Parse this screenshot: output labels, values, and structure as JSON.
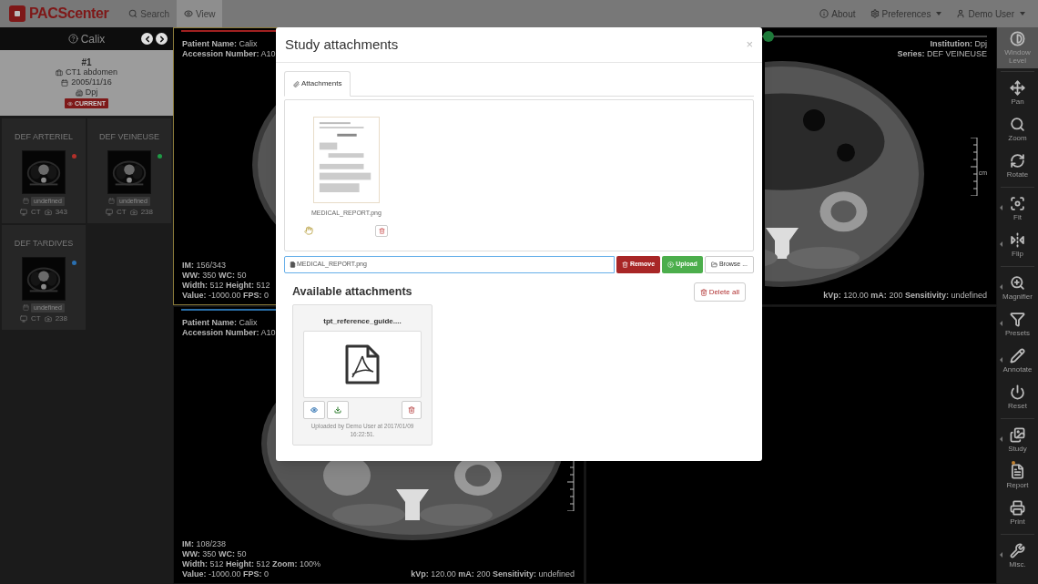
{
  "navbar": {
    "brand": "PACScenter",
    "items": [
      {
        "label": "Search",
        "selected": false
      },
      {
        "label": "View",
        "selected": true
      }
    ],
    "right_items": [
      {
        "label": "About",
        "dropdown": false
      },
      {
        "label": "Preferences",
        "dropdown": true
      },
      {
        "label": "Demo User",
        "dropdown": true
      }
    ]
  },
  "sidebar": {
    "patient": "Calix",
    "study": {
      "number": "#1",
      "description": "CT1 abdomen",
      "date": "2005/11/16",
      "institution": "Dpj",
      "badge": "CURRENT"
    },
    "series": [
      {
        "title": "DEF ARTERIEL",
        "color": "#b0302a",
        "date": "undefined",
        "modality": "CT",
        "images": "343"
      },
      {
        "title": "DEF VEINEUSE",
        "color": "#1f9a45",
        "date": "undefined",
        "modality": "CT",
        "images": "238"
      },
      {
        "title": "DEF TARDIVES",
        "color": "#2a6fb0",
        "date": "undefined",
        "modality": "CT",
        "images": "238"
      }
    ]
  },
  "viewports": [
    {
      "selected": true,
      "color": "#a02020",
      "image": {
        "kind": "picture"
      },
      "top_left": [
        [
          {
            "label": "Patient Name:",
            "value": "Calix"
          }
        ],
        [
          {
            "label": "Accession Number:",
            "value": "A10"
          }
        ]
      ],
      "bottom_left": [
        [
          {
            "label": "IM:",
            "value": "156/343"
          }
        ],
        [
          {
            "label": "WW:",
            "value": "350"
          },
          {
            "label": "WC:",
            "value": "50"
          }
        ],
        [
          {
            "label": "Width:",
            "value": "512"
          },
          {
            "label": "Height:",
            "value": "512"
          }
        ],
        [
          {
            "label": "Value:",
            "value": "-1000.00"
          },
          {
            "label": "FPS:",
            "value": "0"
          }
        ]
      ]
    },
    {
      "selected": false,
      "slider": {
        "level": 0.45
      },
      "image": {
        "kind": "picture"
      },
      "ruler_unit": "cm",
      "top_right": [
        [
          {
            "label": "Institution:",
            "value": "Dpj"
          }
        ],
        [
          {
            "label": "Series:",
            "value": "DEF VEINEUSE"
          }
        ]
      ],
      "bottom_right": [
        [
          {
            "label": "kVp:",
            "value": "120.00"
          },
          {
            "label": "mA:",
            "value": "200"
          },
          {
            "label": "Sensitivity:",
            "value": "undefined"
          }
        ]
      ]
    },
    {
      "selected": false,
      "color": "#2a6fa8",
      "image": {
        "kind": "picture"
      },
      "top_left": [
        [
          {
            "label": "Patient Name:",
            "value": "Calix"
          }
        ],
        [
          {
            "label": "Accession Number:",
            "value": "A10"
          }
        ]
      ],
      "bottom_left": [
        [
          {
            "label": "IM:",
            "value": "108/238"
          }
        ],
        [
          {
            "label": "WW:",
            "value": "350"
          },
          {
            "label": "WC:",
            "value": "50"
          }
        ],
        [
          {
            "label": "Width:",
            "value": "512"
          },
          {
            "label": "Height:",
            "value": "512"
          },
          {
            "label": "Zoom:",
            "value": "100%"
          }
        ],
        [
          {
            "label": "Value:",
            "value": "-1000.00"
          },
          {
            "label": "FPS:",
            "value": "0"
          }
        ]
      ],
      "bottom_right": [
        [
          {
            "label": "kVp:",
            "value": "120.00"
          },
          {
            "label": "mA:",
            "value": "200"
          },
          {
            "label": "Sensitivity:",
            "value": "undefined"
          }
        ]
      ]
    },
    {
      "selected": false
    }
  ],
  "toolbar": {
    "groups": [
      {
        "items": [
          {
            "label": "Window Level",
            "selected": true,
            "submenu": false
          }
        ]
      },
      {
        "items": [
          {
            "label": "Pan",
            "selected": false,
            "submenu": false
          },
          {
            "label": "Zoom",
            "selected": false,
            "submenu": false
          },
          {
            "label": "Rotate",
            "selected": false,
            "submenu": false
          }
        ]
      },
      {
        "items": [
          {
            "label": "Fit",
            "selected": false,
            "submenu": true
          },
          {
            "label": "Flip",
            "selected": false,
            "submenu": true
          }
        ]
      },
      {
        "items": [
          {
            "label": "Magnifier",
            "selected": false,
            "submenu": true
          },
          {
            "label": "Presets",
            "selected": false,
            "submenu": true
          },
          {
            "label": "Annotate",
            "selected": false,
            "submenu": true
          },
          {
            "label": "Reset",
            "selected": false,
            "submenu": false
          }
        ]
      },
      {
        "items": [
          {
            "label": "Study",
            "selected": false,
            "submenu": true
          },
          {
            "label": "Report",
            "selected": false,
            "submenu": false,
            "notification": true
          },
          {
            "label": "Print",
            "selected": false,
            "submenu": false
          }
        ]
      },
      {
        "items": [
          {
            "label": "Misc.",
            "selected": false,
            "submenu": true
          }
        ]
      }
    ]
  },
  "modal": {
    "title": "Study attachments",
    "close": "×",
    "tabs": [
      {
        "label": "Attachments",
        "selected": true
      }
    ],
    "pending": {
      "preview": {
        "kind": "picture"
      },
      "name": "MEDICAL_REPORT.png"
    },
    "file_field": {
      "value": "MEDICAL_REPORT.png"
    },
    "buttons": [
      {
        "label": "Remove",
        "kind": "danger"
      },
      {
        "label": "Upload",
        "kind": "success"
      },
      {
        "label": "Browse ...",
        "kind": "default"
      }
    ],
    "available_title": "Available attachments",
    "delete_all": "Delete all",
    "attachments": [
      {
        "name": "tpt_reference_guide....",
        "uploaded": "Uploaded by Demo User at 2017/01/09 16:22:51."
      }
    ]
  }
}
